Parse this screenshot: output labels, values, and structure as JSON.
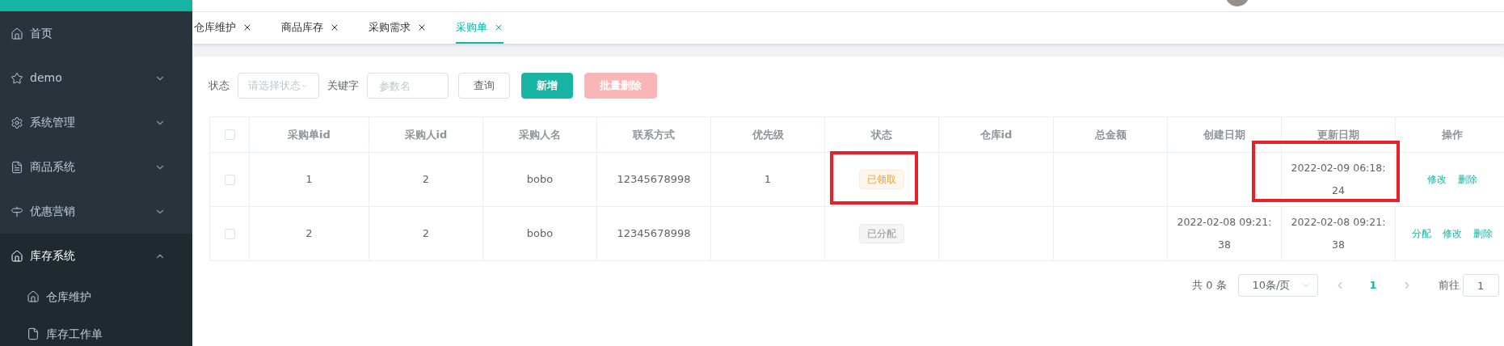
{
  "sidebar": {
    "items": [
      {
        "label": "首页",
        "expanded": false,
        "has_children": false
      },
      {
        "label": "demo",
        "expanded": false,
        "has_children": true
      },
      {
        "label": "系统管理",
        "expanded": false,
        "has_children": true
      },
      {
        "label": "商品系统",
        "expanded": false,
        "has_children": true
      },
      {
        "label": "优惠营销",
        "expanded": false,
        "has_children": true
      },
      {
        "label": "库存系统",
        "expanded": true,
        "has_children": true,
        "children": [
          {
            "label": "仓库维护"
          },
          {
            "label": "库存工作单"
          }
        ]
      }
    ]
  },
  "tabs": [
    {
      "label": "仓库维护",
      "selected": false
    },
    {
      "label": "商品库存",
      "selected": false
    },
    {
      "label": "采购需求",
      "selected": false
    },
    {
      "label": "采购单",
      "selected": true
    }
  ],
  "filters": {
    "status_label": "状态",
    "status_placeholder": "请选择状态",
    "keyword_label": "关键字",
    "keyword_placeholder": "参数名",
    "buttons": [
      {
        "label": "查询",
        "kind": "plain"
      },
      {
        "label": "新增",
        "kind": "primary"
      },
      {
        "label": "批量删除",
        "kind": "danger-disabled"
      }
    ]
  },
  "table": {
    "header_checked": false,
    "columns": [
      "采购单id",
      "采购人id",
      "采购人名",
      "联系方式",
      "优先级",
      "状态",
      "仓库id",
      "总金额",
      "创建日期",
      "更新日期",
      "操作"
    ],
    "rows": [
      {
        "checked": false,
        "cells": [
          "1",
          "2",
          "bobo",
          "12345678998",
          "1"
        ],
        "status": {
          "label": "已领取",
          "kind": "warning",
          "highlighted": true
        },
        "warehouse_id": "",
        "total": "",
        "created": "",
        "updated": {
          "text": "2022-02-09 06:18:24",
          "highlighted": true
        },
        "actions": [
          "修改",
          "删除"
        ]
      },
      {
        "checked": false,
        "cells": [
          "2",
          "2",
          "bobo",
          "12345678998",
          ""
        ],
        "status": {
          "label": "已分配",
          "kind": "info",
          "highlighted": false
        },
        "warehouse_id": "",
        "total": "",
        "created": "2022-02-08 09:21:38",
        "updated": {
          "text": "2022-02-08 09:21:38",
          "highlighted": false
        },
        "actions": [
          "分配",
          "修改",
          "删除"
        ]
      }
    ]
  },
  "pagination": {
    "total": "共 0 条",
    "page_size": "10条/页",
    "current_page": "1",
    "goto_label": "前往",
    "goto_value": "1"
  }
}
